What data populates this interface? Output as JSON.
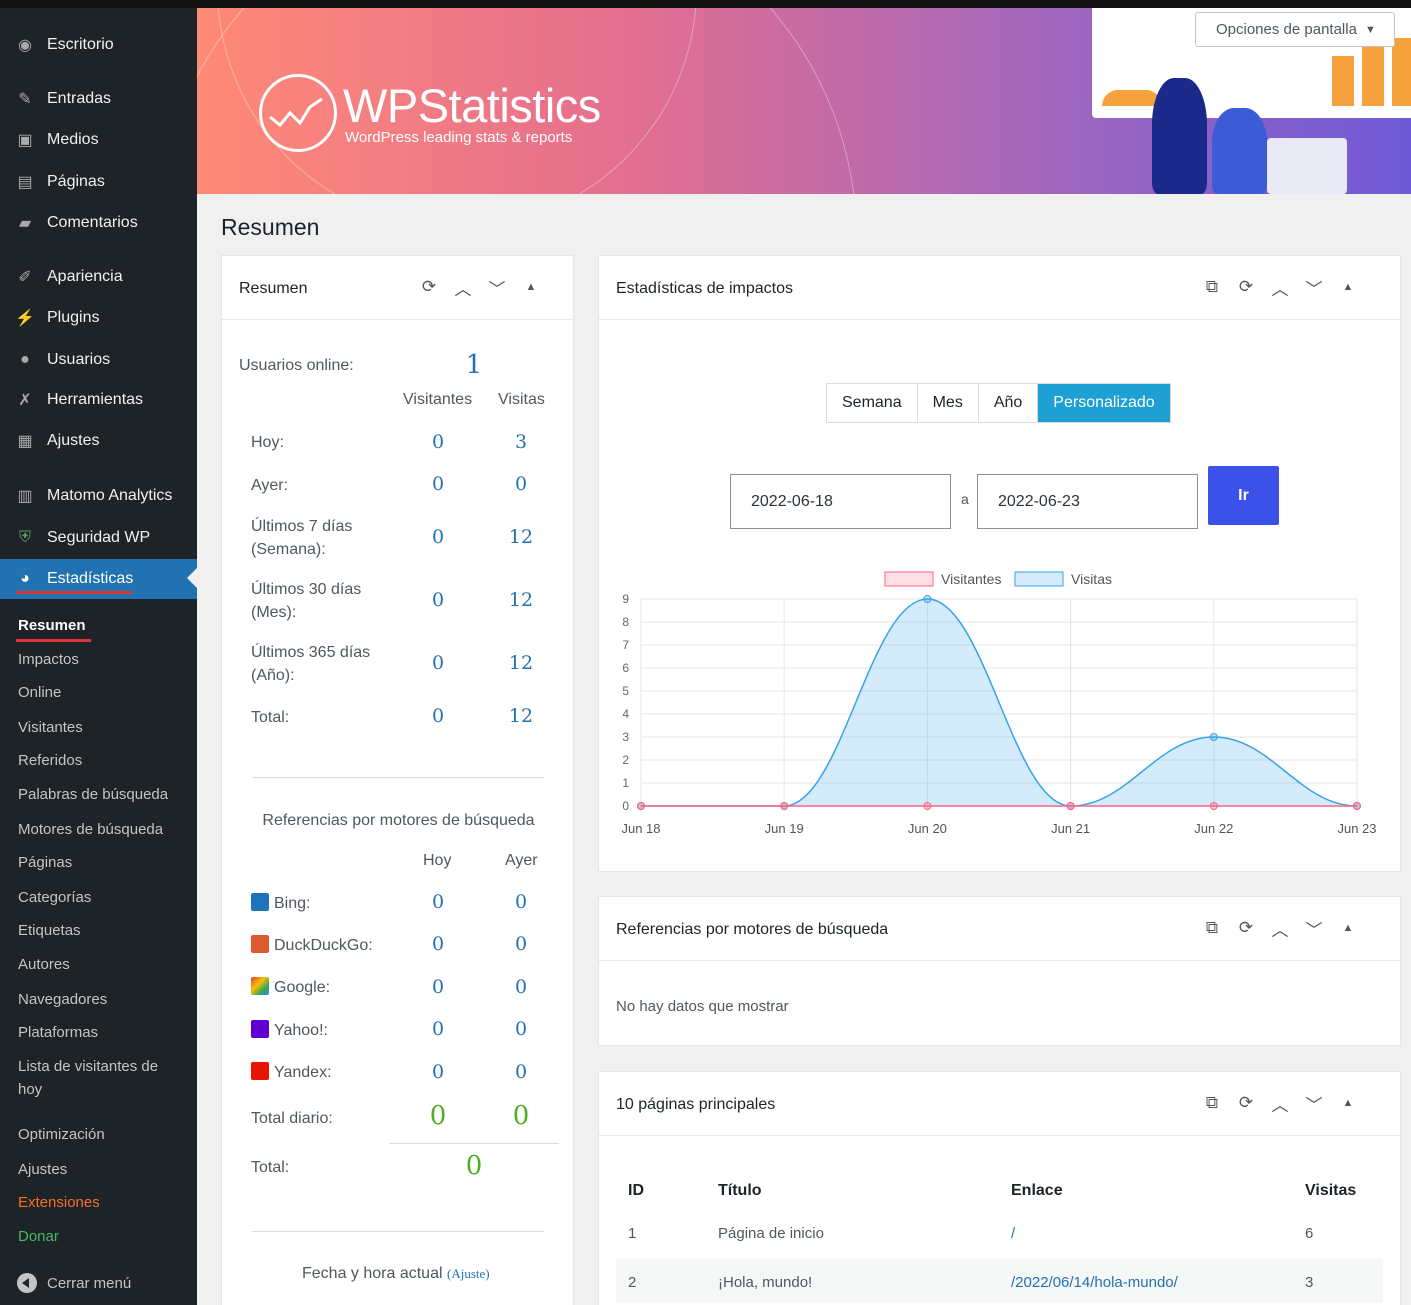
{
  "sidebar": {
    "menu": [
      {
        "label": "Escritorio",
        "icon": "dashboard-icon"
      },
      {
        "label": "Entradas",
        "icon": "pin-icon"
      },
      {
        "label": "Medios",
        "icon": "media-icon"
      },
      {
        "label": "Páginas",
        "icon": "pages-icon"
      },
      {
        "label": "Comentarios",
        "icon": "comment-icon"
      },
      {
        "label": "Apariencia",
        "icon": "brush-icon"
      },
      {
        "label": "Plugins",
        "icon": "plugin-icon"
      },
      {
        "label": "Usuarios",
        "icon": "users-icon"
      },
      {
        "label": "Herramientas",
        "icon": "wrench-icon"
      },
      {
        "label": "Ajustes",
        "icon": "settings-icon"
      },
      {
        "label": "Matomo Analytics",
        "icon": "matomo-icon"
      },
      {
        "label": "Seguridad WP",
        "icon": "shield-icon"
      },
      {
        "label": "Estadísticas",
        "icon": "pie-chart-icon"
      }
    ],
    "submenu": [
      "Resumen",
      "Impactos",
      "Online",
      "Visitantes",
      "Referidos",
      "Palabras de búsqueda",
      "Motores de búsqueda",
      "Páginas",
      "Categorías",
      "Etiquetas",
      "Autores",
      "Navegadores",
      "Plataformas",
      "Lista de visitantes de",
      "hoy",
      "Optimización",
      "Ajustes",
      "Extensiones",
      "Donar"
    ],
    "collapse_label": "Cerrar menú"
  },
  "banner": {
    "title": "WPStatistics",
    "subtitle": "WordPress leading stats & reports"
  },
  "screen_options": "Opciones de pantalla",
  "page_title": "Resumen",
  "summary": {
    "title": "Resumen",
    "online_label": "Usuarios online:",
    "online_value": "1",
    "col_visitors": "Visitantes",
    "col_visits": "Visitas",
    "rows": [
      {
        "label1": "Hoy:",
        "label2": "",
        "visitors": "0",
        "visits": "3"
      },
      {
        "label1": "Ayer:",
        "label2": "",
        "visitors": "0",
        "visits": "0"
      },
      {
        "label1": "Últimos 7 días",
        "label2": "(Semana):",
        "visitors": "0",
        "visits": "12"
      },
      {
        "label1": "Últimos 30 días",
        "label2": "(Mes):",
        "visitors": "0",
        "visits": "12"
      },
      {
        "label1": "Últimos 365 días",
        "label2": "(Año):",
        "visitors": "0",
        "visits": "12"
      },
      {
        "label1": "Total:",
        "label2": "",
        "visitors": "0",
        "visits": "12"
      }
    ],
    "search_title": "Referencias por motores de búsqueda",
    "col_today": "Hoy",
    "col_yesterday": "Ayer",
    "engines": [
      {
        "name": "Bing:",
        "today": "0",
        "yesterday": "0",
        "color": "#1e73be"
      },
      {
        "name": "DuckDuckGo:",
        "today": "0",
        "yesterday": "0",
        "color": "#de5833"
      },
      {
        "name": "Google:",
        "today": "0",
        "yesterday": "0",
        "color": "#34a853"
      },
      {
        "name": "Yahoo!:",
        "today": "0",
        "yesterday": "0",
        "color": "#6001d2"
      },
      {
        "name": "Yandex:",
        "today": "0",
        "yesterday": "0",
        "color": "#e61400"
      }
    ],
    "daily_total_label": "Total diario:",
    "daily_total_today": "0",
    "daily_total_yesterday": "0",
    "total_label": "Total:",
    "total_value": "0",
    "datetime_label": "Fecha y hora actual",
    "datetime_link": "(Ajuste)"
  },
  "hits": {
    "title": "Estadísticas de impactos",
    "segments": [
      "Semana",
      "Mes",
      "Año",
      "Personalizado"
    ],
    "active_segment": "Personalizado",
    "date_from": "2022-06-18",
    "date_sep": "a",
    "date_to": "2022-06-23",
    "go_label": "Ir"
  },
  "chart_data": {
    "type": "area",
    "categories": [
      "Jun 18",
      "Jun 19",
      "Jun 20",
      "Jun 21",
      "Jun 22",
      "Jun 23"
    ],
    "series": [
      {
        "name": "Visitantes",
        "values": [
          0,
          0,
          0,
          0,
          0,
          0
        ],
        "color": "#ff6384"
      },
      {
        "name": "Visitas",
        "values": [
          0,
          0,
          9,
          0,
          3,
          0
        ],
        "color": "#36a2eb"
      }
    ],
    "y_ticks": [
      "0",
      "1",
      "2",
      "3",
      "4",
      "5",
      "6",
      "7",
      "8",
      "9"
    ],
    "ylim": [
      0,
      9
    ],
    "legend": "top",
    "grid": true
  },
  "search_refs": {
    "title": "Referencias por motores de búsqueda",
    "empty": "No hay datos que mostrar"
  },
  "top_pages": {
    "title": "10 páginas principales",
    "headers": [
      "ID",
      "Título",
      "Enlace",
      "Visitas"
    ],
    "rows": [
      {
        "id": "1",
        "title": "Página de inicio",
        "link": "/",
        "visits": "6"
      },
      {
        "id": "2",
        "title": "¡Hola, mundo!",
        "link": "/2022/06/14/hola-mundo/",
        "visits": "3"
      }
    ]
  }
}
